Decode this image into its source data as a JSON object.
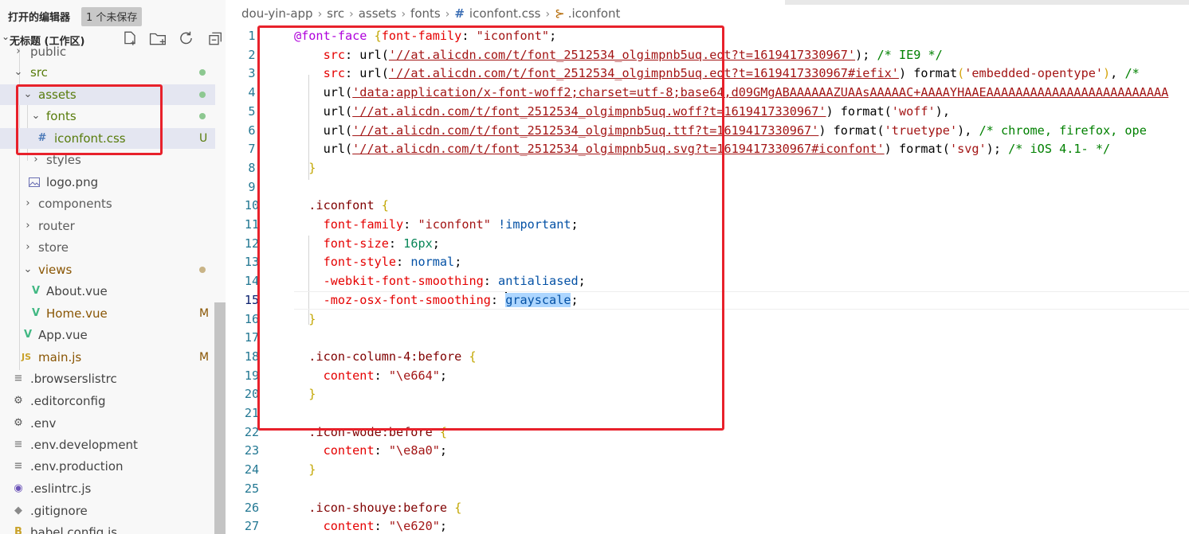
{
  "colors": {
    "annotation": "#e8212b",
    "selection": "#e4e6f1",
    "accent": "#237893"
  },
  "sidebar": {
    "open_editors_title": "打开的编辑器",
    "unsaved_badge": "1 个未保存",
    "workspace_title": "无标题 (工作区)",
    "actions": [
      "new-file-icon",
      "new-folder-icon",
      "refresh-icon",
      "collapse-all-icon"
    ],
    "items": [
      {
        "label": "public",
        "status": ""
      },
      {
        "label": "src",
        "status": "●"
      },
      {
        "label": "assets",
        "status": "●"
      },
      {
        "label": "fonts",
        "status": "●"
      },
      {
        "label": "iconfont.css",
        "icon": "#",
        "status": "U"
      },
      {
        "label": "styles",
        "status": ""
      },
      {
        "label": "logo.png",
        "status": ""
      },
      {
        "label": "components",
        "status": ""
      },
      {
        "label": "router",
        "status": ""
      },
      {
        "label": "store",
        "status": ""
      },
      {
        "label": "views",
        "status": "●"
      },
      {
        "label": "About.vue",
        "status": ""
      },
      {
        "label": "Home.vue",
        "status": "M"
      },
      {
        "label": "App.vue",
        "status": ""
      },
      {
        "label": "main.js",
        "icon": "JS",
        "status": "M"
      },
      {
        "label": ".browserslistrc",
        "status": ""
      },
      {
        "label": ".editorconfig",
        "status": ""
      },
      {
        "label": ".env",
        "status": ""
      },
      {
        "label": ".env.development",
        "status": ""
      },
      {
        "label": ".env.production",
        "status": ""
      },
      {
        "label": ".eslintrc.js",
        "status": ""
      },
      {
        "label": ".gitignore",
        "status": ""
      },
      {
        "label": "babel.config.js",
        "status": ""
      }
    ]
  },
  "breadcrumb": [
    "dou-yin-app",
    "src",
    "assets",
    "fonts",
    "iconfont.css",
    ".iconfont"
  ],
  "editor": {
    "active_line": "15",
    "lines": [
      {
        "n": "1",
        "t": [
          [
            "k-at",
            "@font-face "
          ],
          [
            "k-brace",
            "{"
          ],
          [
            "k-prop",
            "font-family"
          ],
          [
            "",
            ": "
          ],
          [
            "k-str",
            "\"iconfont\""
          ],
          [
            "",
            ";"
          ]
        ]
      },
      {
        "n": "2",
        "t": [
          [
            "",
            "    "
          ],
          [
            "k-prop",
            "src"
          ],
          [
            "",
            ": url("
          ],
          [
            "k-url",
            "'//at.alicdn.com/t/font_2512534_olgimpnb5uq.eot?t=1619417330967'"
          ],
          [
            "",
            "); "
          ],
          [
            "k-com",
            "/* IE9 */"
          ]
        ]
      },
      {
        "n": "3",
        "t": [
          [
            "",
            "    "
          ],
          [
            "k-prop",
            "src"
          ],
          [
            "",
            ": url("
          ],
          [
            "k-url",
            "'//at.alicdn.com/t/font_2512534_olgimpnb5uq.eot?t=1619417330967#iefix'"
          ],
          [
            "",
            ") format"
          ],
          [
            "k-brace2",
            "("
          ],
          [
            "k-str",
            "'embedded-opentype'"
          ],
          [
            "k-brace2",
            ")"
          ],
          [
            "",
            ", "
          ],
          [
            "k-com",
            "/*"
          ]
        ]
      },
      {
        "n": "4",
        "t": [
          [
            "",
            "    url("
          ],
          [
            "k-url",
            "'data:application/x-font-woff2;charset=utf-8;base64,d09GMgABAAAAAAZUAAsAAAAAC+AAAAYHAAEAAAAAAAAAAAAAAAAAAAAAAAAA"
          ]
        ]
      },
      {
        "n": "5",
        "t": [
          [
            "",
            "    url("
          ],
          [
            "k-url",
            "'//at.alicdn.com/t/font_2512534_olgimpnb5uq.woff?t=1619417330967'"
          ],
          [
            "",
            ") format("
          ],
          [
            "k-str",
            "'woff'"
          ],
          [
            "",
            "),"
          ]
        ]
      },
      {
        "n": "6",
        "t": [
          [
            "",
            "    url("
          ],
          [
            "k-url",
            "'//at.alicdn.com/t/font_2512534_olgimpnb5uq.ttf?t=1619417330967'"
          ],
          [
            "",
            ") format("
          ],
          [
            "k-str",
            "'truetype'"
          ],
          [
            "",
            "), "
          ],
          [
            "k-com",
            "/* chrome, firefox, ope"
          ]
        ]
      },
      {
        "n": "7",
        "t": [
          [
            "",
            "    url("
          ],
          [
            "k-url",
            "'//at.alicdn.com/t/font_2512534_olgimpnb5uq.svg?t=1619417330967#iconfont'"
          ],
          [
            "",
            ") format("
          ],
          [
            "k-str",
            "'svg'"
          ],
          [
            "",
            "); "
          ],
          [
            "k-com",
            "/* iOS 4.1- */"
          ]
        ]
      },
      {
        "n": "8",
        "t": [
          [
            "",
            "  "
          ],
          [
            "k-brace",
            "}"
          ]
        ]
      },
      {
        "n": "9",
        "t": []
      },
      {
        "n": "10",
        "t": [
          [
            "",
            "  "
          ],
          [
            "k-sel",
            ".iconfont"
          ],
          [
            "",
            " "
          ],
          [
            "k-brace",
            "{"
          ]
        ]
      },
      {
        "n": "11",
        "t": [
          [
            "",
            "    "
          ],
          [
            "k-prop",
            "font-family"
          ],
          [
            "",
            ": "
          ],
          [
            "k-str",
            "\"iconfont\""
          ],
          [
            "",
            " "
          ],
          [
            "k-val",
            "!important"
          ],
          [
            "",
            ";"
          ]
        ]
      },
      {
        "n": "12",
        "t": [
          [
            "",
            "    "
          ],
          [
            "k-prop",
            "font-size"
          ],
          [
            "",
            ": "
          ],
          [
            "k-num",
            "16px"
          ],
          [
            "",
            ";"
          ]
        ]
      },
      {
        "n": "13",
        "t": [
          [
            "",
            "    "
          ],
          [
            "k-prop",
            "font-style"
          ],
          [
            "",
            ": "
          ],
          [
            "k-val",
            "normal"
          ],
          [
            "",
            ";"
          ]
        ]
      },
      {
        "n": "14",
        "t": [
          [
            "",
            "    "
          ],
          [
            "k-prop",
            "-webkit-font-smoothing"
          ],
          [
            "",
            ": "
          ],
          [
            "k-val",
            "antialiased"
          ],
          [
            "",
            ";"
          ]
        ]
      },
      {
        "n": "15",
        "t": [
          [
            "",
            "    "
          ],
          [
            "k-prop",
            "-moz-osx-font-smoothing"
          ],
          [
            "",
            ": "
          ],
          [
            "cursor",
            ""
          ],
          [
            "k-val hl-sel",
            "grayscale"
          ],
          [
            "",
            ";"
          ]
        ]
      },
      {
        "n": "16",
        "t": [
          [
            "",
            "  "
          ],
          [
            "k-brace",
            "}"
          ]
        ]
      },
      {
        "n": "17",
        "t": []
      },
      {
        "n": "18",
        "t": [
          [
            "",
            "  "
          ],
          [
            "k-sel",
            ".icon-column-4:before"
          ],
          [
            "",
            " "
          ],
          [
            "k-brace",
            "{"
          ]
        ]
      },
      {
        "n": "19",
        "t": [
          [
            "",
            "    "
          ],
          [
            "k-prop",
            "content"
          ],
          [
            "",
            ": "
          ],
          [
            "k-str",
            "\"\\e664\""
          ],
          [
            "",
            ";"
          ]
        ]
      },
      {
        "n": "20",
        "t": [
          [
            "",
            "  "
          ],
          [
            "k-brace",
            "}"
          ]
        ]
      },
      {
        "n": "21",
        "t": []
      },
      {
        "n": "22",
        "t": [
          [
            "",
            "  "
          ],
          [
            "k-sel",
            ".icon-wode:before"
          ],
          [
            "",
            " "
          ],
          [
            "k-brace",
            "{"
          ]
        ]
      },
      {
        "n": "23",
        "t": [
          [
            "",
            "    "
          ],
          [
            "k-prop",
            "content"
          ],
          [
            "",
            ": "
          ],
          [
            "k-str",
            "\"\\e8a0\""
          ],
          [
            "",
            ";"
          ]
        ]
      },
      {
        "n": "24",
        "t": [
          [
            "",
            "  "
          ],
          [
            "k-brace",
            "}"
          ]
        ]
      },
      {
        "n": "25",
        "t": []
      },
      {
        "n": "26",
        "t": [
          [
            "",
            "  "
          ],
          [
            "k-sel",
            ".icon-shouye:before"
          ],
          [
            "",
            " "
          ],
          [
            "k-brace",
            "{"
          ]
        ]
      },
      {
        "n": "27",
        "t": [
          [
            "",
            "    "
          ],
          [
            "k-prop",
            "content"
          ],
          [
            "",
            ": "
          ],
          [
            "k-str",
            "\"\\e620\""
          ],
          [
            "",
            ";"
          ]
        ]
      }
    ]
  }
}
